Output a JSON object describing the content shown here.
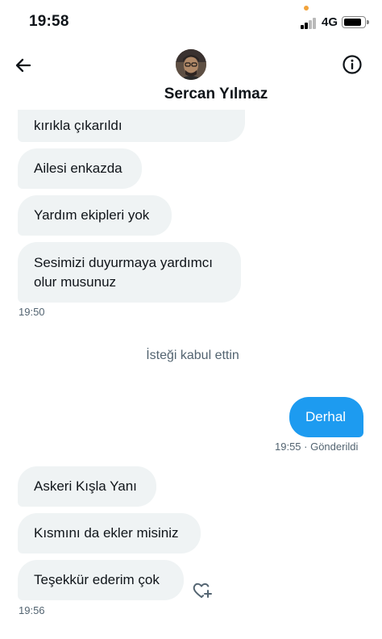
{
  "status_bar": {
    "time": "19:58",
    "network": "4G"
  },
  "header": {
    "contact_name": "Sercan Yılmaz"
  },
  "messages": {
    "m1": "kırıkla çıkarıldı",
    "m2": "Ailesi enkazda",
    "m3": "Yardım ekipleri yok",
    "m4_line1": "Sesimizi duyurmaya yardımcı",
    "m4_line2": "olur musunuz",
    "time_group1": "19:50",
    "system_notice": "İsteği kabul ettin",
    "sent_text": "Derhal",
    "sent_meta": "19:55 · Gönderildi",
    "m5": "Askeri Kışla Yanı",
    "m6": "Kısmını da ekler misiniz",
    "m7": "Teşekkür ederim çok",
    "time_group2": "19:56"
  },
  "icons": {
    "back": "arrow-left",
    "info": "info-circle",
    "react": "heart-plus"
  },
  "colors": {
    "accent": "#1d9bf0",
    "incoming_bubble": "#eff3f4",
    "muted_text": "#536471"
  }
}
